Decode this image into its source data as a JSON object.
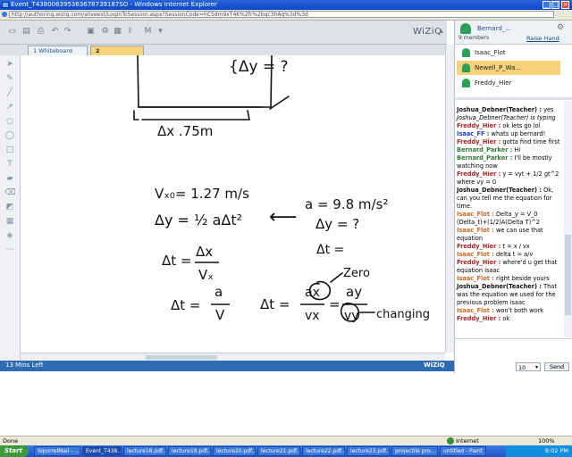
{
  "window": {
    "title": "Event_T438006395363678739187SO - Windows Internet Explorer",
    "url": "http://authoring.wiziq.com/aliveext/LoginToSession.aspx?SessionCode=hC5dm9xT4K%2fr%2bqc3hAq%3d%3d"
  },
  "app": {
    "logo": "WiZiQ",
    "tabs": [
      "1 Whiteboard",
      "2 Whiteboard"
    ],
    "time_left": "13 Mins Left",
    "footer_logo": "WiZiQ"
  },
  "whiteboard": {
    "notes": {
      "dy_label": "{Δy = ?",
      "dx_label": "Δx  .75m",
      "vx0": "Vₓ₀= 1.27 m/s",
      "dy_eq": "Δy =  ½ aΔt²",
      "arrow": "⟵",
      "a_val": "a = 9.8 m/s²",
      "dy_q": "Δy = ?",
      "dt_eq_blank": "Δt =",
      "dt_dx": "Δt =",
      "dx_frac_top": "Δx",
      "dx_frac_bot": "Vₓ",
      "dt_av": "Δt =",
      "a_frac_top": "a",
      "a_frac_bot": "V",
      "dt_ratio": "Δt =",
      "r_top1": "ax",
      "r_bot1": "vx",
      "eq": "=",
      "r_top2": "ay",
      "r_bot2": "vy",
      "zero": "Zero",
      "changing": "changing"
    }
  },
  "panel": {
    "user": "Bernard_...",
    "members_count": "9 members",
    "raise_hand": "Raise Hand",
    "members": [
      "Isaac_Flot",
      "Newell_P_Wa...",
      "Freddy_Hier"
    ],
    "chat": [
      {
        "who": "Joshua_Debner(Teacher) :",
        "msg": "yes",
        "color": "#111111"
      },
      {
        "who": "",
        "msg": "Joshua_Debner(Teacher) is typing",
        "color": "#333333"
      },
      {
        "who": "Freddy_Hier :",
        "msg": "ok lets go lol",
        "color": "#b22222"
      },
      {
        "who": "Isaac_FF :",
        "msg": "whats up bernard!",
        "color": "#1f3fbf"
      },
      {
        "who": "Freddy_Hier :",
        "msg": "gotta find time first",
        "color": "#b22222"
      },
      {
        "who": "Bernard_Parker :",
        "msg": "Hi",
        "color": "#2e7d32"
      },
      {
        "who": "Bernard_Parker :",
        "msg": "I'll be mostly watching now",
        "color": "#2e7d32"
      },
      {
        "who": "Freddy_Hier :",
        "msg": "y = vyt + 1/2 gt^2 where vy = 0",
        "color": "#b22222"
      },
      {
        "who": "Joshua_Debner(Teacher) :",
        "msg": "Ok, can you tell me the equation for time.",
        "color": "#111111"
      },
      {
        "who": "Isaac_Flot :",
        "msg": "Delta_y = V_0 (Delta_t)+(1/2)A(Delta T)^2",
        "color": "#d2691e"
      },
      {
        "who": "Isaac_Flot :",
        "msg": "we can use that equation",
        "color": "#d2691e"
      },
      {
        "who": "Freddy_Hier :",
        "msg": "t = x / vx",
        "color": "#b22222"
      },
      {
        "who": "Isaac_Flot :",
        "msg": "delta t = a/v",
        "color": "#d2691e"
      },
      {
        "who": "Freddy_Hier :",
        "msg": "where'd u get that equation isaac",
        "color": "#b22222"
      },
      {
        "who": "Isaac_Flot :",
        "msg": "right beside yours",
        "color": "#d2691e"
      },
      {
        "who": "Joshua_Debner(Teacher) :",
        "msg": "That was the equation we used for the previous problem isaac",
        "color": "#111111"
      },
      {
        "who": "Isaac_Flot :",
        "msg": "won't both work",
        "color": "#d2691e"
      },
      {
        "who": "Freddy_Hier :",
        "msg": "ok",
        "color": "#b22222"
      }
    ],
    "font_size": "10",
    "send": "Send"
  },
  "ie_status": {
    "left": "Done",
    "zone": "Internet",
    "zoom": "100%"
  },
  "taskbar": {
    "start": "Start",
    "tasks": [
      "SquirrelMail - ...",
      "Event_T438...",
      "lecture18.pdf...",
      "lecture19.pdf...",
      "lecture20.pdf...",
      "lecture21.pdf...",
      "lecture22.pdf...",
      "lecture23.pdf...",
      "projectile pro...",
      "untitled - Paint"
    ],
    "clock": "9:02 PM"
  }
}
